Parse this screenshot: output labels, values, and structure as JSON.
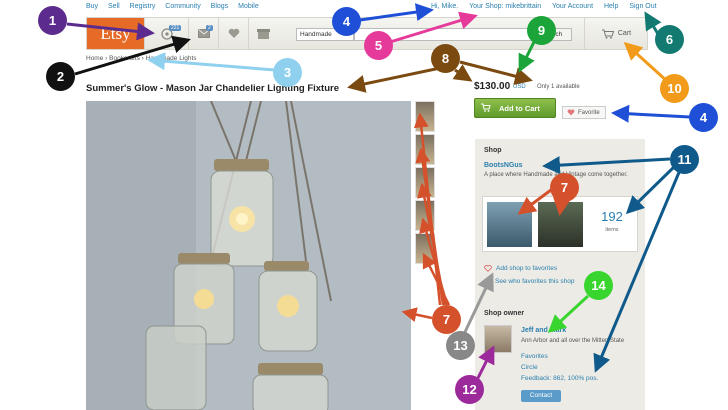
{
  "topnav": {
    "links": [
      "Buy",
      "Sell",
      "Registry",
      "Community",
      "Blogs",
      "Mobile"
    ]
  },
  "usernav": {
    "greeting": "Hi, Mike.",
    "your_shop": "Your Shop: mikebrittain",
    "account": "Your Account",
    "help": "Help",
    "signout": "Sign Out"
  },
  "header": {
    "logo": "Etsy",
    "badge_activity": "221",
    "badge_messages": "2",
    "select_value": "Handmade",
    "search_button": "Search",
    "cart": "Cart"
  },
  "breadcrumb": "Home › Bookcrafts › Handmade Lights",
  "listing": {
    "title": "Summer's Glow - Mason Jar Chandelier Lighting Fixture",
    "price": "$130.00",
    "currency": "USD",
    "availability": "Only 1 available",
    "add_to_cart": "Add to Cart",
    "favorite": "Favorite"
  },
  "shop": {
    "heading": "Shop",
    "name": "BootsNGus",
    "description": "A place where Handmade and Vintage come together.",
    "item_count": "192",
    "items_label": "items",
    "add_favorites": "Add shop to favorites",
    "see_favorites": "See who favorites this shop"
  },
  "owner": {
    "heading": "Shop owner",
    "name": "Jeff and Mark",
    "location": "Ann Arbor and all over the Mitten State",
    "favorites": "Favorites",
    "circle": "Circle",
    "feedback": "Feedback: 862, 100% pos.",
    "contact": "Contact"
  },
  "markers": {
    "m1": "1",
    "m2": "2",
    "m3": "3",
    "m4a": "4",
    "m4b": "4",
    "m5": "5",
    "m6": "6",
    "m7a": "7",
    "m7b": "7",
    "m8": "8",
    "m9": "9",
    "m10": "10",
    "m11": "11",
    "m12": "12",
    "m13": "13",
    "m14": "14"
  },
  "colors": {
    "etsy_orange": "#e66b26",
    "link_blue": "#2a7fae",
    "add_to_cart_green": "#6da53a"
  }
}
